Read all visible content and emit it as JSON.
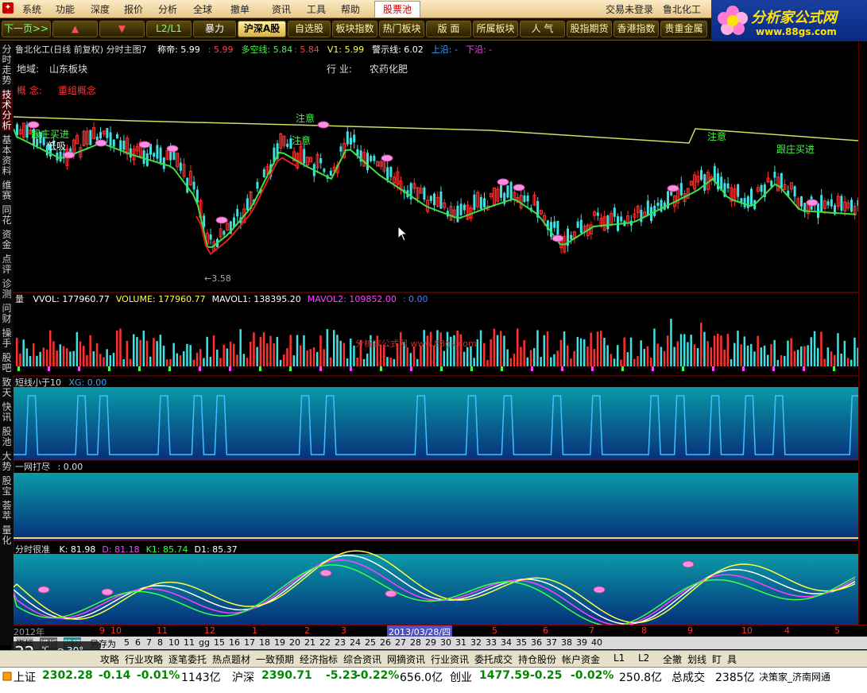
{
  "menu": {
    "items": [
      "系统",
      "功能",
      "深度",
      "报价",
      "分析",
      "全球",
      "撤单",
      "资讯",
      "工具",
      "帮助"
    ],
    "active_tab": "股票池",
    "login": "交易未登录",
    "stock_name": "鲁北化工"
  },
  "logo": {
    "title": "分析家公式网",
    "url": "www.88gs.com"
  },
  "toolbar": {
    "buttons": [
      "下一页>>",
      "▲",
      "▼",
      "L2/L1",
      "暴力",
      "沪深A股",
      "自选股",
      "板块指数",
      "热门板块",
      "版 面",
      "所属板块",
      "人 气",
      "股指期货",
      "香港指数",
      "贵重金属"
    ]
  },
  "left_tabs": [
    "分时走势",
    "技术分析",
    "基本资料",
    "维赛",
    "同花",
    "资金",
    "点评",
    "诊测",
    "问财",
    "操手",
    "股吧",
    "致天",
    "快讯",
    "股池",
    "大势",
    "股宝",
    "荟萃",
    "量化"
  ],
  "main_panel": {
    "title_name": "鲁北化工(日线 前复权) 分时主图7",
    "title_items": [
      {
        "label": "称帝: 5.99",
        "color": "#ffffff"
      },
      {
        "label": ": 5.99",
        "color": "#ff4040"
      },
      {
        "label": "多空线: 5.84",
        "color": "#40ff40"
      },
      {
        "label": ": 5.84",
        "color": "#ff4040"
      },
      {
        "label": "V1: 5.99",
        "color": "#ffff40"
      },
      {
        "label": "警示线: 6.02",
        "color": "#ffffff"
      },
      {
        "label": "上沿: -",
        "color": "#40a0ff"
      },
      {
        "label": "下沿: -",
        "color": "#ff40ff"
      }
    ],
    "region_label": "地域:",
    "region_value": "山东板块",
    "industry_label": "行 业:",
    "industry_value": "农药化肥",
    "concept_label": "概 念:",
    "concept_value": "重组概念",
    "low_price": "←3.58",
    "annotations": [
      "跟庄买进",
      "注意",
      "低吸",
      "跟庄买进",
      "注意",
      "注意"
    ]
  },
  "vol_panel": {
    "title": "量",
    "items": [
      {
        "label": "VVOL: 177960.77",
        "color": "#ffffff"
      },
      {
        "label": "VOLUME: 177960.77",
        "color": "#ffff40"
      },
      {
        "label": "MAVOL1: 138395.20",
        "color": "#ffffff"
      },
      {
        "label": "MAVOL2: 109852.00",
        "color": "#ff40ff"
      },
      {
        "label": ": 0.00",
        "color": "#4080ff"
      }
    ],
    "watermark": "分析家公式网 www.88gs.com"
  },
  "panel3": {
    "title": "短线小于10",
    "item": "XG: 0.00"
  },
  "panel4": {
    "title": "一网打尽",
    "item": ": 0.00"
  },
  "panel5": {
    "title": "分时很准",
    "items": [
      {
        "label": "K: 81.98",
        "color": "#ffffff"
      },
      {
        "label": "D: 81.18",
        "color": "#ff40ff"
      },
      {
        "label": "K1: 85.74",
        "color": "#40ff40"
      },
      {
        "label": "D1: 85.37",
        "color": "#ffffff"
      }
    ]
  },
  "time_axis": {
    "labels": [
      "2012年",
      "9",
      "10",
      "11",
      "12",
      "1",
      "2",
      "3",
      "2013/03/28/四",
      "5",
      "6",
      "7",
      "8",
      "9",
      "10",
      "4",
      "5",
      "6"
    ],
    "highlight": "2013/03/28/四"
  },
  "page_bar": {
    "tabs": [
      "指标",
      "模板",
      "管理"
    ],
    "label": "另存为",
    "numbers": [
      "5",
      "6",
      "7",
      "8",
      "10",
      "11",
      "gg",
      "15",
      "16",
      "17",
      "18",
      "19",
      "20",
      "21",
      "22",
      "23",
      "24",
      "25",
      "26",
      "27",
      "28",
      "29",
      "30",
      "31",
      "32",
      "33",
      "34",
      "35",
      "36",
      "37",
      "38",
      "39",
      "40"
    ]
  },
  "info_tabs": [
    "攻略",
    "行业攻略",
    "逐笔委托",
    "热点题材",
    "一致预期",
    "经济指标",
    "综合资讯",
    "网摘资讯",
    "行业资讯",
    "委托成交",
    "持仓股份",
    "帐户资金",
    "L1",
    "L2",
    "全撤",
    "划线",
    "盯",
    "具"
  ],
  "weather": {
    "aqi": "32",
    "temp": "30°",
    "unit": "℃"
  },
  "status": {
    "sh_label": "上证",
    "sh_value": "2302.28",
    "sh_change": "-0.14",
    "sh_pct": "-0.01%",
    "sh_amount": "1143亿",
    "hs_label": "沪深",
    "hs_value": "2390.71",
    "hs_change": "-5.23",
    "hs_pct": "-0.22%",
    "hs_amount": "656.0亿",
    "cy_label": "创业",
    "cy_value": "1477.59",
    "cy_change": "-0.25",
    "cy_pct": "-0.02%",
    "cy_amount": "250.8亿",
    "total_label": "总成交",
    "total_value": "2385亿",
    "broker": "决策家_济南网通"
  },
  "colors": {
    "up": "#ff3030",
    "down": "#40e0e0",
    "ma_green": "#40e040",
    "ma_red": "#e02020",
    "guide": "#d0e060"
  }
}
